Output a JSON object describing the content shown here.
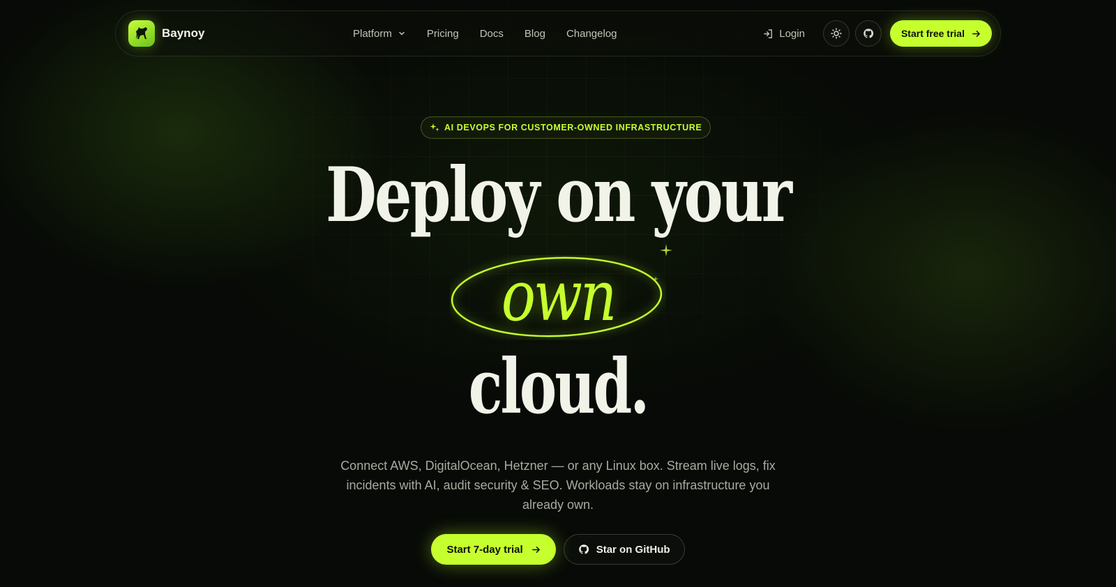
{
  "brand": {
    "name": "Baynoy",
    "logo_icon": "horse-logo-icon"
  },
  "nav": {
    "links": [
      {
        "label": "Platform",
        "has_dropdown": true
      },
      {
        "label": "Pricing"
      },
      {
        "label": "Docs"
      },
      {
        "label": "Blog"
      },
      {
        "label": "Changelog"
      }
    ],
    "login_label": "Login",
    "theme_toggle_icon": "sun-icon",
    "github_icon": "github-icon",
    "cta_label": "Start free trial"
  },
  "hero": {
    "badge": "AI DEVOPS FOR CUSTOMER-OWNED INFRASTRUCTURE",
    "headline_line1": "Deploy on your",
    "headline_highlight": "own",
    "headline_line3": "cloud.",
    "subtext": "Connect AWS, DigitalOcean, Hetzner — or any Linux box. Stream live logs, fix incidents with AI, audit security & SEO. Workloads stay on infrastructure you already own.",
    "primary_cta": "Start 7-day trial",
    "secondary_cta": "Star on GitHub"
  },
  "colors": {
    "accent": "#c6ff2e",
    "background": "#070a06",
    "text": "#f1f3e8",
    "muted": "#a7ab9f"
  }
}
